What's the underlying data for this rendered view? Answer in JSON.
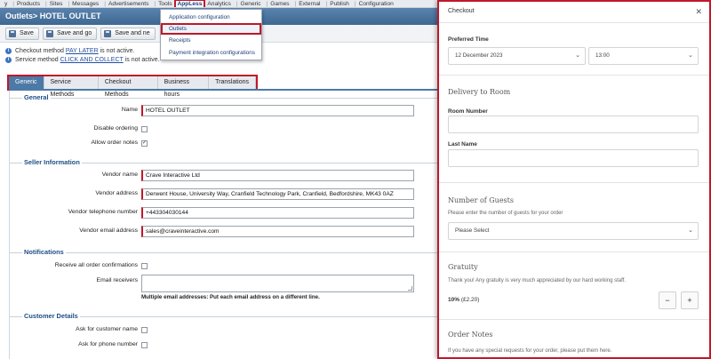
{
  "menubar": {
    "items": [
      "y",
      "Products",
      "Sites",
      "Messages",
      "Advertisements",
      "Tools",
      "AppLess",
      "Analytics",
      "Generic",
      "Games",
      "External",
      "Publish",
      "Configuration"
    ],
    "active": "AppLess"
  },
  "titlebar": {
    "title": "Outlets> HOTEL OUTLET"
  },
  "toolbar": {
    "save_label": "Save",
    "save_go_label": "Save and go",
    "save_new_label": "Save and ne"
  },
  "info": {
    "line1_pre": "Checkout method ",
    "line1_link": "PAY LATER",
    "line1_post": " is not active.",
    "line2_pre": "Service method ",
    "line2_link": "CLICK AND COLLECT",
    "line2_post": " is not active."
  },
  "dropdown": {
    "items": [
      "Application configuration",
      "Outlets",
      "Receipts",
      "Payment integration configurations"
    ],
    "highlighted": "Outlets"
  },
  "tabs": [
    "Generic",
    "Service Methods",
    "Checkout Methods",
    "Business hours",
    "Translations"
  ],
  "selected_tab": "Generic",
  "form": {
    "general_heading": "General",
    "name_label": "Name",
    "name_value": "HOTEL OUTLET",
    "disable_ordering_label": "Disable ordering",
    "allow_notes_label": "Allow order notes",
    "allow_notes_checked": "✓",
    "seller_heading": "Seller Information",
    "vendor_name_label": "Vendor name",
    "vendor_name_value": "Crave Interactive Ltd",
    "vendor_address_label": "Vendor address",
    "vendor_address_value": "Derwent House, University Way, Cranfield Technology Park, Cranfield, Bedfordshire, MK43 0AZ",
    "vendor_phone_label": "Vendor telephone number",
    "vendor_phone_value": "+443304030144",
    "vendor_email_label": "Vendor email address",
    "vendor_email_value": "sales@craveinteractive.com",
    "notifications_heading": "Notifications",
    "receive_confirmations_label": "Receive all order confirmations",
    "email_receivers_label": "Email receivers",
    "email_receivers_note": "Multiple email addresses: Put each email address on a different line.",
    "customer_heading": "Customer Details",
    "ask_name_label": "Ask for customer name",
    "ask_phone_label": "Ask for phone number"
  },
  "panel": {
    "title": "Checkout",
    "close": "✕",
    "preferred_time_label": "Preferred Time",
    "date_value": "12 December 2023",
    "time_value": "13:00",
    "delivery_heading": "Delivery to Room",
    "room_number_label": "Room Number",
    "last_name_label": "Last Name",
    "guests_heading": "Number of Guests",
    "guests_text": "Please enter the number of guests for your order",
    "guests_select": "Please Select",
    "gratuity_heading": "Gratuity",
    "gratuity_text": "Thank you! Any gratuity is very much appreciated by our hard working staff.",
    "gratuity_pct": "10%",
    "gratuity_amount": "(£2.20)",
    "minus": "−",
    "plus": "+",
    "notes_heading": "Order Notes",
    "notes_text": "If you have any special requests for your order, please put them here."
  },
  "colors": {
    "highlight_red": "#c0182a",
    "title_blue": "#3e6892",
    "tab_selected": "#4d79a6"
  }
}
